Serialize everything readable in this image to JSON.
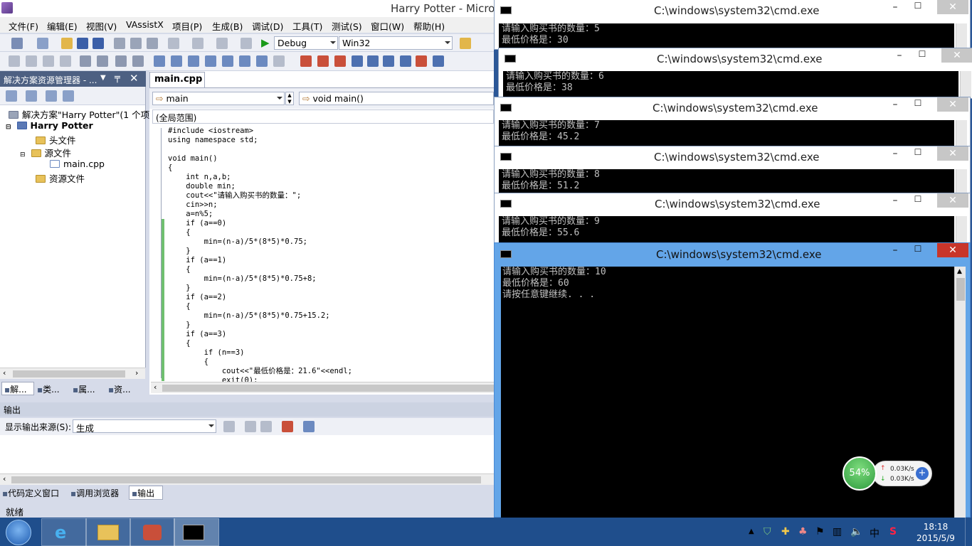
{
  "vs": {
    "title": "Harry Potter - Micro",
    "menu": [
      "文件(F)",
      "编辑(E)",
      "视图(V)",
      "VAssistX",
      "项目(P)",
      "生成(B)",
      "调试(D)",
      "工具(T)",
      "测试(S)",
      "窗口(W)",
      "帮助(H)"
    ],
    "config_combo": "Debug",
    "platform_combo": "Win32",
    "solution_explorer": {
      "title": "解决方案资源管理器 - ...",
      "solution": "解决方案\"Harry Potter\"(1 个项目",
      "project": "Harry Potter",
      "folder_headers": "头文件",
      "folder_sources": "源文件",
      "file_main": "main.cpp",
      "folder_resources": "资源文件",
      "bottom_tabs": [
        "解...",
        "类...",
        "属...",
        "资..."
      ]
    },
    "editor": {
      "tab": "main.cpp",
      "scope_combo": "main",
      "func_combo": "void main()",
      "global_scope": "(全局范围)",
      "code": "#include <iostream>\nusing namespace std;\n\nvoid main()\n{\n    int n,a,b;\n    double min;\n    cout<<\"请输入购买书的数量：\";\n    cin>>n;\n    a=n%5;\n    if (a==0)\n    {\n        min=(n-a)/5*(8*5)*0.75;\n    }\n    if (a==1)\n    {\n        min=(n-a)/5*(8*5)*0.75+8;\n    }\n    if (a==2)\n    {\n        min=(n-a)/5*(8*5)*0.75+15.2;\n    }\n    if (a==3)\n    {\n        if (n==3)\n        {\n            cout<<\"最低价格是：21.6\"<<endl;\n            exit(0);"
    },
    "output": {
      "title": "输出",
      "source_label": "显示输出来源(S):",
      "source_value": "生成"
    },
    "bottom_tabs": [
      "代码定义窗口",
      "调用浏览器",
      "输出"
    ],
    "status": "就绪"
  },
  "cmd_windows": [
    {
      "title": "C:\\windows\\system32\\cmd.exe",
      "lines": [
        "请输入购买书的数量：5",
        "最低价格是：30"
      ]
    },
    {
      "title": "C:\\windows\\system32\\cmd.exe",
      "lines": [
        "请输入购买书的数量：6",
        "最低价格是：38"
      ]
    },
    {
      "title": "C:\\windows\\system32\\cmd.exe",
      "lines": [
        "请输入购买书的数量：7",
        "最低价格是：45.2"
      ]
    },
    {
      "title": "C:\\windows\\system32\\cmd.exe",
      "lines": [
        "请输入购买书的数量：8",
        "最低价格是：51.2"
      ]
    },
    {
      "title": "C:\\windows\\system32\\cmd.exe",
      "lines": [
        "请输入购买书的数量：9",
        "最低价格是：55.6"
      ]
    },
    {
      "title": "C:\\windows\\system32\\cmd.exe",
      "lines": [
        "请输入购买书的数量：10",
        "最低价格是：60",
        "请按任意键继续. . ."
      ]
    }
  ],
  "net_widget": {
    "cpu": "54%",
    "up": "0.03K/s",
    "down": "0.03K/s"
  },
  "taskbar": {
    "ime": "中",
    "time": "18:18",
    "date": "2015/5/9"
  }
}
